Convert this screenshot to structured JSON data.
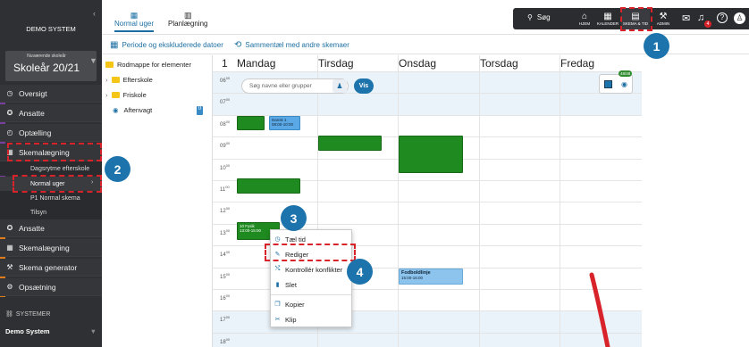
{
  "sidebar": {
    "system_name": "DEMO SYSTEM",
    "year_label": "Nuværende skoleår",
    "year_value": "Skoleår 20/21",
    "section1": [
      "Oversigt",
      "Ansatte",
      "Optælling",
      "Skemalægning"
    ],
    "sub1": [
      "Dagsrytme efterskole",
      "Normal uger",
      "P1 Normal skema",
      "Tilsyn"
    ],
    "section2": [
      "Ansatte",
      "Skemalægning",
      "Skema generator",
      "Opsætning"
    ],
    "systemer_label": "SYSTEMER",
    "demo_system": "Demo System"
  },
  "topbar": {
    "search": "Søg",
    "items": [
      "HJEM",
      "KALENDER",
      "SKEMA & TID",
      "ADMIN"
    ],
    "badge": "4"
  },
  "tabs": [
    "Normal uger",
    "Planlægning"
  ],
  "toolbar": {
    "periode": "Periode og ekskluderede datoer",
    "sammentael": "Sammentæl med andre skemaer"
  },
  "tree": {
    "root": "Rodmappe for elementer",
    "items": [
      "Efterskole",
      "Friskole",
      "Aftenvagt"
    ],
    "count": "0"
  },
  "calendar": {
    "week_num": "1",
    "days": [
      "Mandag",
      "Tirsdag",
      "Onsdag",
      "Torsdag",
      "Fredag"
    ],
    "times": [
      "06",
      "07",
      "08",
      "09",
      "10",
      "11",
      "12",
      "13",
      "14",
      "15",
      "16",
      "17",
      "18"
    ],
    "time_suffix": "00",
    "search_placeholder": "Søg navne eller grupper",
    "vis": "Vis",
    "counter": "48/48",
    "events": [
      {
        "label": "Dansk 1",
        "time": "08:00-10:00"
      },
      {
        "label": "10 Fysik",
        "time": "13:00-15:00"
      },
      {
        "label": "Fodboldlinje",
        "time": "15:00-16:00"
      }
    ]
  },
  "context_menu": [
    "Tæl tid",
    "Rediger",
    "Kontrollér konflikter",
    "Slet",
    "Kopier",
    "Klip"
  ],
  "steps": [
    "1",
    "2",
    "3",
    "4"
  ]
}
